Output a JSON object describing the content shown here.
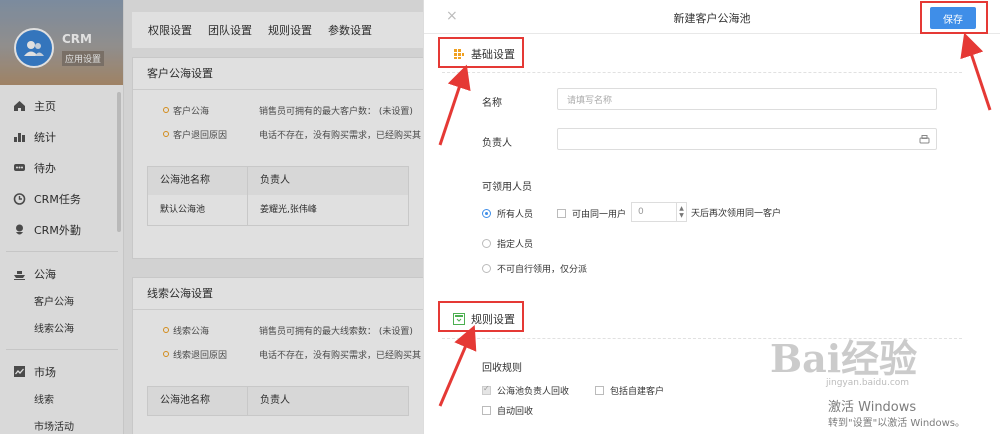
{
  "brand": {
    "title": "CRM",
    "badge": "应用设置"
  },
  "sidebar": {
    "items": [
      {
        "label": "主页",
        "icon": "home-icon"
      },
      {
        "label": "统计",
        "icon": "chart-icon"
      },
      {
        "label": "待办",
        "icon": "todo-icon"
      },
      {
        "label": "CRM任务",
        "icon": "alarm-icon"
      },
      {
        "label": "CRM外勤",
        "icon": "pin-icon"
      }
    ],
    "sea_group": {
      "label": "公海",
      "icon": "boat-icon",
      "subs": [
        "客户公海",
        "线索公海"
      ]
    },
    "market_group": {
      "label": "市场",
      "icon": "trend-icon",
      "subs": [
        "线索",
        "市场活动"
      ]
    }
  },
  "topnav": {
    "tabs": [
      "权限设置",
      "团队设置",
      "规则设置",
      "参数设置"
    ]
  },
  "customer_panel": {
    "title": "客户公海设置",
    "rules": [
      {
        "label": "客户公海",
        "text": "销售员可拥有的最大客户数：   (未设置)"
      },
      {
        "label": "客户退回原因",
        "text": "电话不存在，没有购买需求，已经购买其"
      }
    ],
    "table": {
      "headers": [
        "公海池名称",
        "负责人"
      ],
      "rows": [
        [
          "默认公海池",
          "姜耀光,张伟峰"
        ]
      ]
    }
  },
  "lead_panel": {
    "title": "线索公海设置",
    "rules": [
      {
        "label": "线索公海",
        "text": "销售员可拥有的最大线索数：   (未设置)"
      },
      {
        "label": "线索退回原因",
        "text": "电话不存在，没有购买需求，已经购买其"
      }
    ],
    "table": {
      "headers": [
        "公海池名称",
        "负责人"
      ]
    }
  },
  "modal": {
    "title": "新建客户公海池",
    "close": "×",
    "save": "保存",
    "basic": {
      "title": "基础设置",
      "name_label": "名称",
      "name_placeholder": "请填写名称",
      "owner_label": "负责人",
      "users_label": "可领用人员",
      "all_users": "所有人员",
      "same_user": "可由同一用户",
      "days_value": "0",
      "days_suffix": "天后再次领用同一客户",
      "specified": "指定人员",
      "assign_only": "不可自行领用，仅分派"
    },
    "rules": {
      "title": "规则设置",
      "recycle_label": "回收规则",
      "owner_recycle": "公海池负责人回收",
      "include_self": "包括自建客户",
      "auto_recycle": "自动回收"
    }
  },
  "watermark": {
    "baidu": "Bai经验",
    "site": "jingyan.baidu.com",
    "win1": "激活 Windows",
    "win2": "转到\"设置\"以激活 Windows。"
  },
  "colors": {
    "accent": "#3f8ee8",
    "highlight": "#e53935",
    "icon_orange": "#f0a020",
    "icon_green": "#4caf50"
  }
}
